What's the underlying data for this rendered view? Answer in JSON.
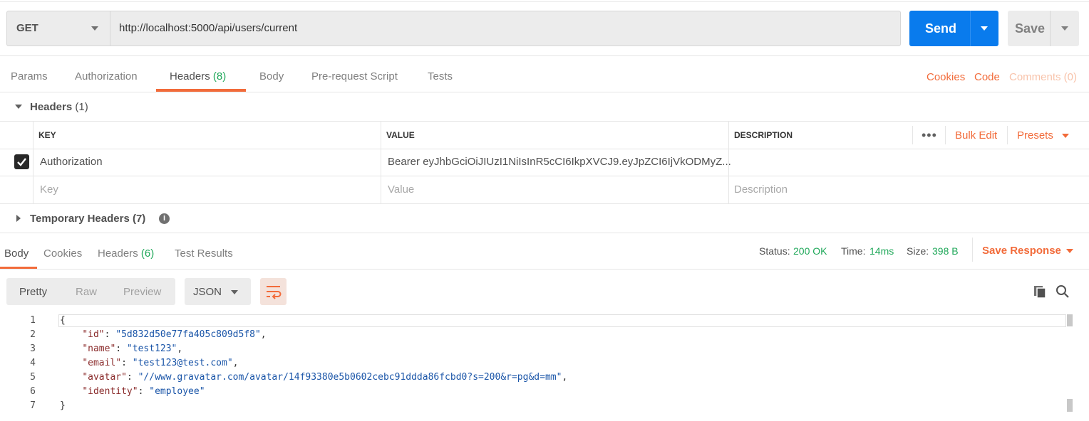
{
  "request": {
    "method": "GET",
    "url": "http://localhost:5000/api/users/current",
    "send_label": "Send",
    "save_label": "Save"
  },
  "request_tabs": [
    {
      "label": "Params",
      "count": ""
    },
    {
      "label": "Authorization",
      "count": ""
    },
    {
      "label": "Headers",
      "count": "(8)"
    },
    {
      "label": "Body",
      "count": ""
    },
    {
      "label": "Pre-request Script",
      "count": ""
    },
    {
      "label": "Tests",
      "count": ""
    }
  ],
  "right_links": {
    "cookies": "Cookies",
    "code": "Code",
    "comments": "Comments (0)"
  },
  "headers_section": {
    "title": "Headers",
    "count": "(1)",
    "columns": {
      "key": "KEY",
      "value": "VALUE",
      "description": "DESCRIPTION"
    },
    "bulk_edit": "Bulk Edit",
    "presets": "Presets",
    "rows": [
      {
        "key": "Authorization",
        "value": "Bearer eyJhbGciOiJIUzI1NiIsInR5cCI6IkpXVCJ9.eyJpZCI6IjVkODMyZ...",
        "description": "",
        "checked": true
      }
    ],
    "placeholder": {
      "key": "Key",
      "value": "Value",
      "description": "Description"
    }
  },
  "temporary_headers": {
    "title": "Temporary Headers",
    "count": "(7)"
  },
  "response_tabs": [
    {
      "label": "Body",
      "count": ""
    },
    {
      "label": "Cookies",
      "count": ""
    },
    {
      "label": "Headers",
      "count": "(6)"
    },
    {
      "label": "Test Results",
      "count": ""
    }
  ],
  "status": {
    "status_label": "Status:",
    "status_value": "200 OK",
    "time_label": "Time:",
    "time_value": "14ms",
    "size_label": "Size:",
    "size_value": "398 B",
    "save_response": "Save Response"
  },
  "view": {
    "modes": [
      "Pretty",
      "Raw",
      "Preview"
    ],
    "format": "JSON"
  },
  "body_lines": [
    {
      "n": "1",
      "key": "",
      "value": "",
      "text": "{"
    },
    {
      "n": "2",
      "key": "\"id\"",
      "value": "\"5d832d50e77fa405c809d5f8\"",
      "text": ","
    },
    {
      "n": "3",
      "key": "\"name\"",
      "value": "\"test123\"",
      "text": ","
    },
    {
      "n": "4",
      "key": "\"email\"",
      "value": "\"test123@test.com\"",
      "text": ","
    },
    {
      "n": "5",
      "key": "\"avatar\"",
      "value": "\"//www.gravatar.com/avatar/14f93380e5b0602cebc91ddda86fcbd0?s=200&r=pg&d=mm\"",
      "text": ","
    },
    {
      "n": "6",
      "key": "\"identity\"",
      "value": "\"employee\"",
      "text": ""
    },
    {
      "n": "7",
      "key": "",
      "value": "",
      "text": "}"
    }
  ]
}
